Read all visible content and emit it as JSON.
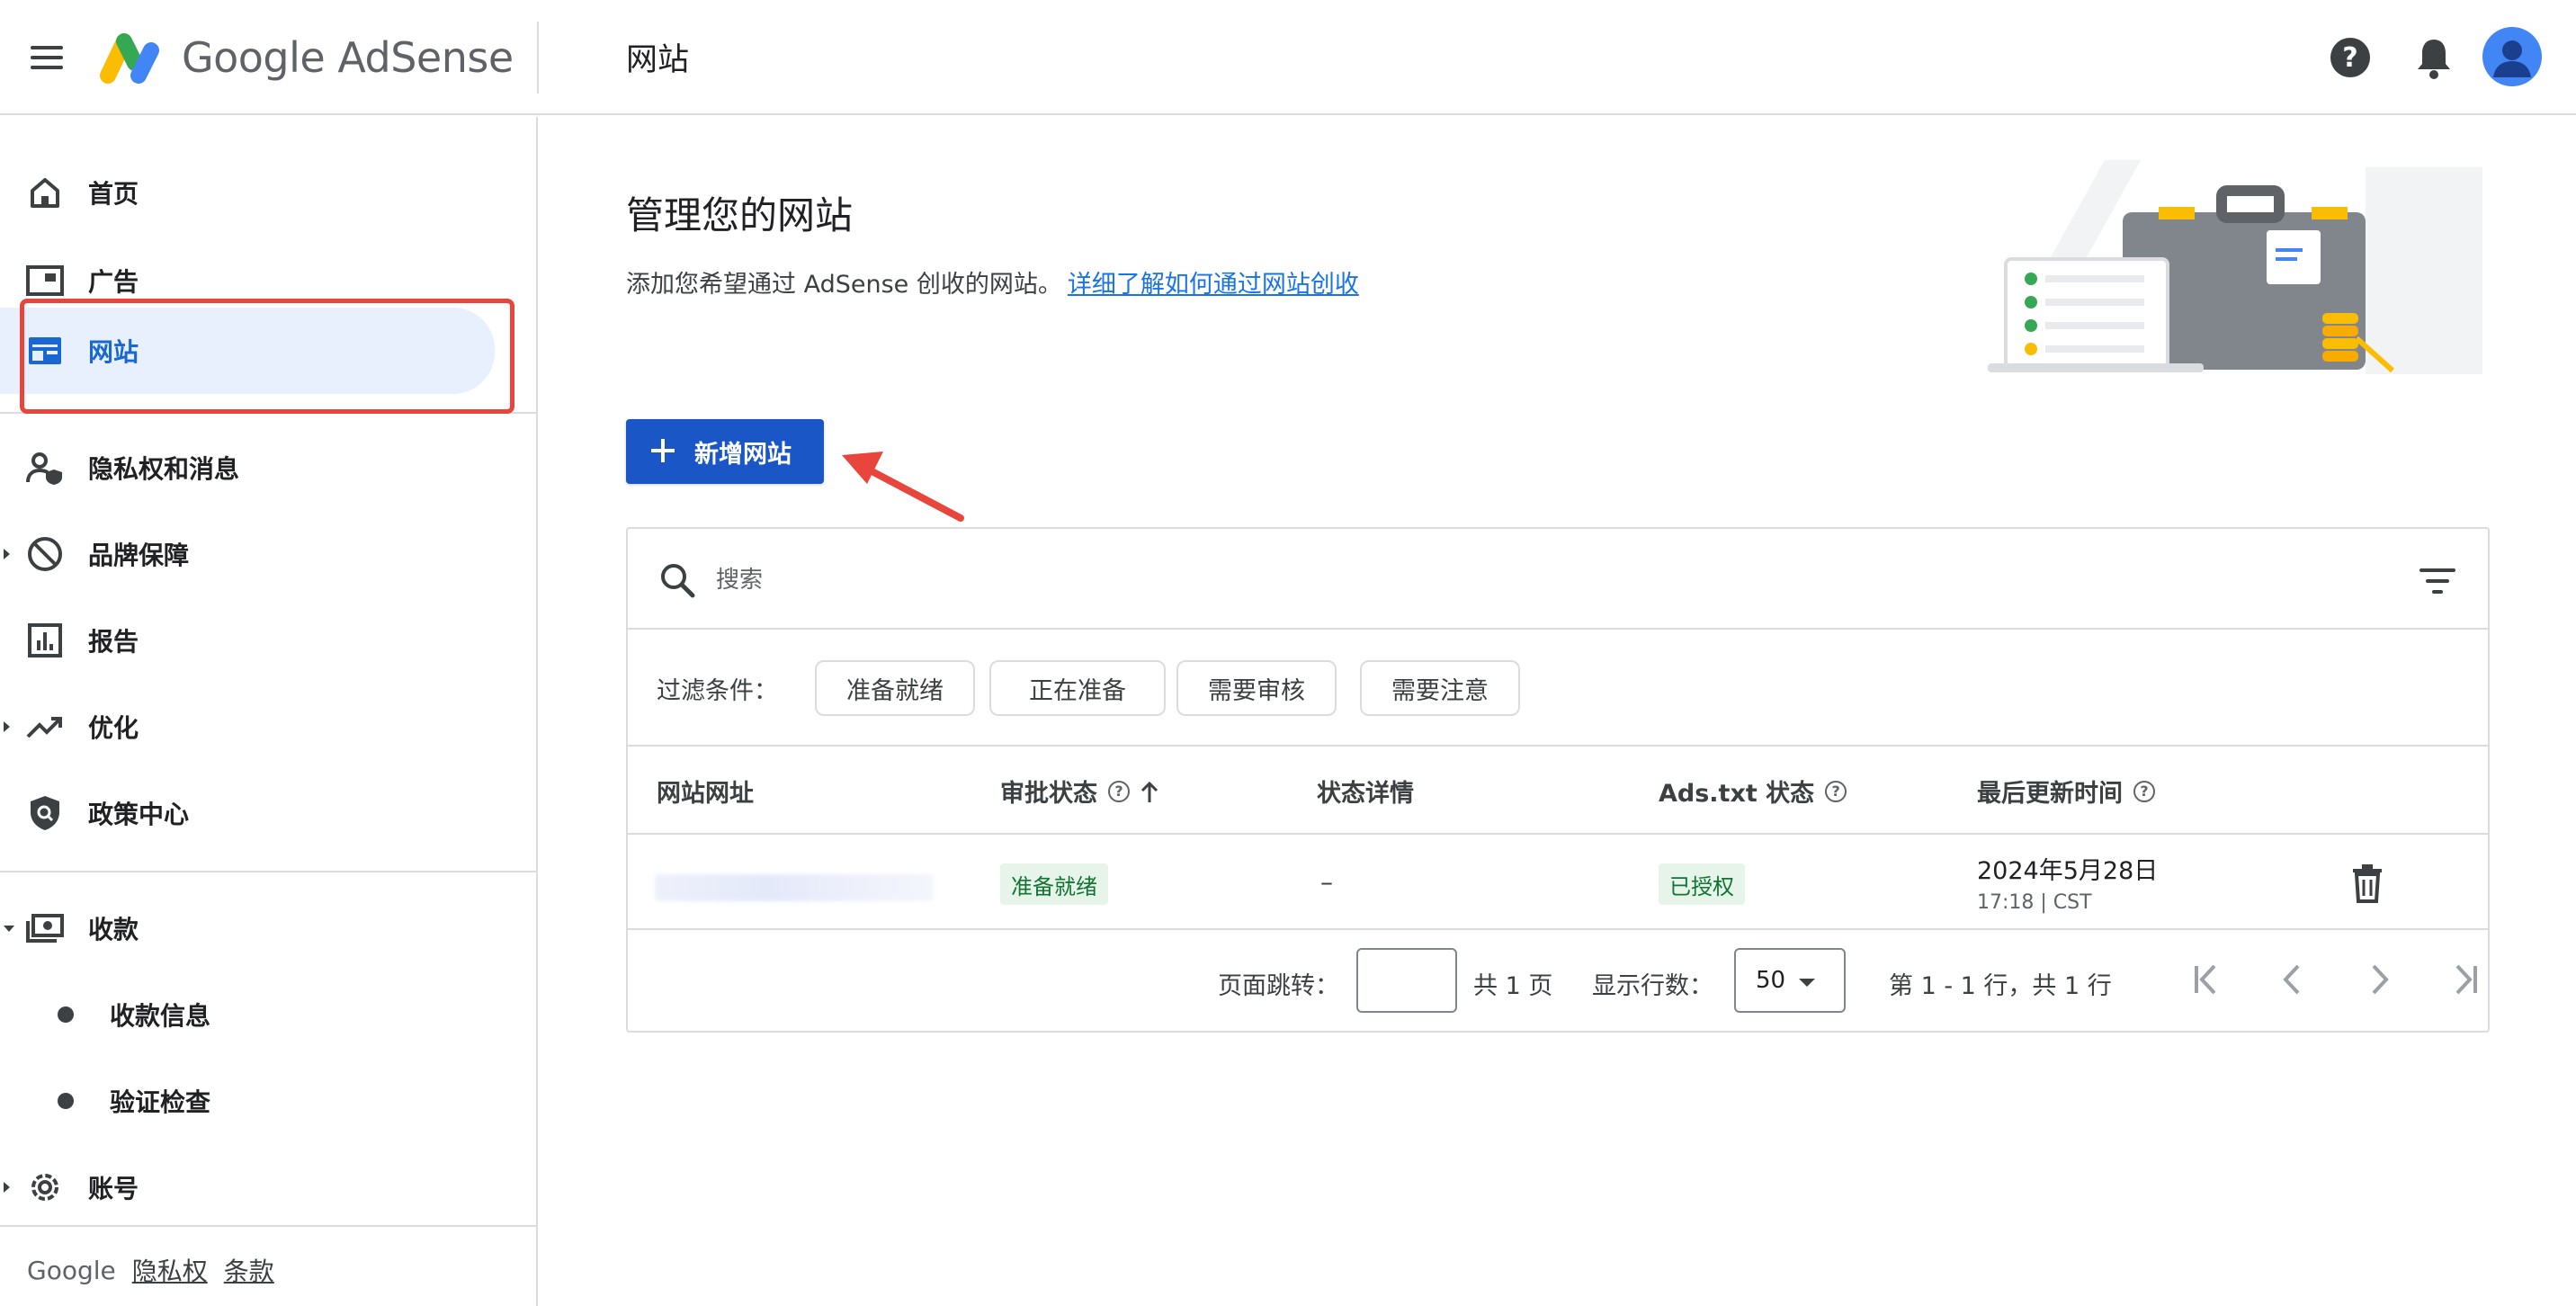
{
  "header": {
    "app_name": "Google AdSense",
    "page_heading": "网站",
    "help_symbol": "?"
  },
  "sidebar": {
    "items": [
      {
        "label": "首页",
        "icon": "home-icon"
      },
      {
        "label": "广告",
        "icon": "ads-icon"
      },
      {
        "label": "网站",
        "icon": "sites-icon",
        "active": true
      },
      {
        "label": "隐私权和消息",
        "icon": "privacy-icon"
      },
      {
        "label": "品牌保障",
        "icon": "block-icon"
      },
      {
        "label": "报告",
        "icon": "reports-icon"
      },
      {
        "label": "优化",
        "icon": "trending-icon"
      },
      {
        "label": "政策中心",
        "icon": "policy-shield-icon"
      },
      {
        "label": "收款",
        "icon": "payments-icon"
      },
      {
        "label": "账号",
        "icon": "gear-icon"
      }
    ],
    "payment_sub_items": [
      {
        "label": "收款信息"
      },
      {
        "label": "验证检查"
      }
    ],
    "footer": {
      "brand": "Google",
      "privacy": "隐私权",
      "terms": "条款"
    }
  },
  "main": {
    "title": "管理您的网站",
    "description": "添加您希望通过 AdSense 创收的网站。",
    "learn_more_link": "详细了解如何通过网站创收",
    "add_site_button": "新增网站"
  },
  "table": {
    "search_placeholder": "搜索",
    "filter_label": "过滤条件：",
    "filter_chips": [
      "准备就绪",
      "正在准备",
      "需要审核",
      "需要注意"
    ],
    "columns": {
      "site_url": "网站网址",
      "approval_status": "审批状态",
      "status_details": "状态详情",
      "ads_txt_status": "Ads.txt 状态",
      "last_updated": "最后更新时间"
    },
    "rows": [
      {
        "approval_status": "准备就绪",
        "status_details": "–",
        "ads_txt_status": "已授权",
        "updated_date": "2024年5月28日",
        "updated_time": "17:18 | CST"
      }
    ],
    "pagination": {
      "jump_label": "页面跳转：",
      "jump_value": "",
      "total_pages": "共 1 页",
      "rows_label": "显示行数：",
      "rows_per_page": "50",
      "range": "第 1 - 1 行，共 1 行"
    }
  },
  "colors": {
    "primary_button": "#1a56c6",
    "link": "#1a73e8",
    "active_nav_bg": "#e8f0fe",
    "highlight_annotation": "#e8453c",
    "ready_badge_bg": "#e6f4ea",
    "ready_badge_text": "#137333"
  }
}
